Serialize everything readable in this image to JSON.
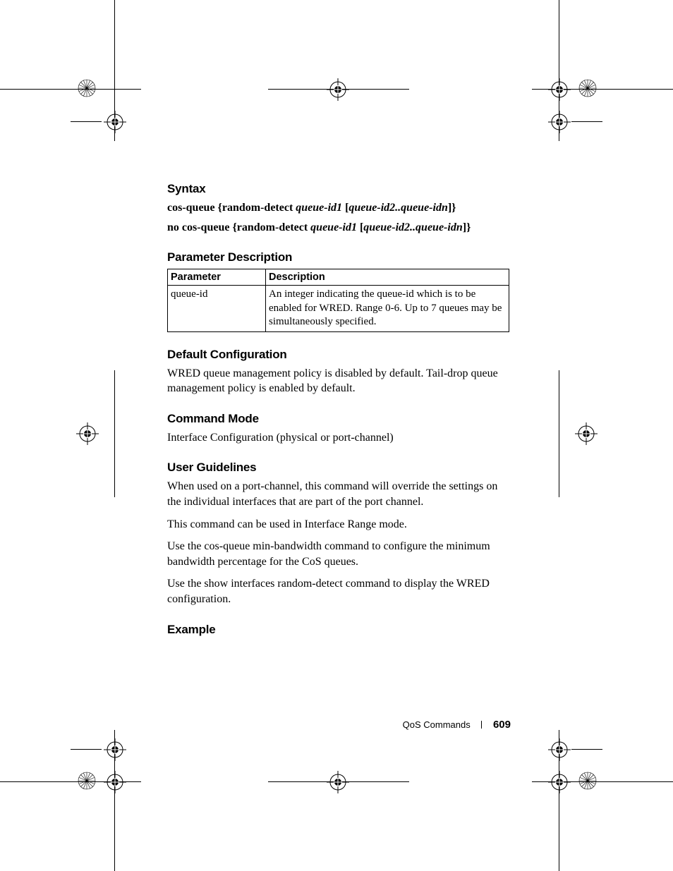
{
  "headings": {
    "syntax": "Syntax",
    "paramdesc": "Parameter Description",
    "defaultcfg": "Default Configuration",
    "cmdmode": "Command Mode",
    "userguide": "User Guidelines",
    "example": "Example"
  },
  "syntax": {
    "line1": {
      "p1": "cos-queue {random-detect ",
      "p2": "queue-id1 ",
      "p3": "[",
      "p4": "queue-id2..queue-idn",
      "p5": "]}"
    },
    "line2": {
      "p1": "no cos-queue {random-detect ",
      "p2": "queue-id1 ",
      "p3": "[",
      "p4": "queue-id2..queue-idn",
      "p5": "]}"
    }
  },
  "table": {
    "h1": "Parameter",
    "h2": "Description",
    "r1c1": "queue-id",
    "r1c2": "An integer indicating the queue-id which is to be enabled for WRED. Range 0-6. Up to 7 queues may be simultaneously specified."
  },
  "defaultcfg_text": "WRED queue management policy is disabled by default. Tail-drop queue management policy is enabled by default.",
  "cmdmode_text": "Interface Configuration (physical or port-channel)",
  "ug": {
    "p1": "When used on a port-channel, this command will override the settings on the individual interfaces that are part of the port channel.",
    "p2": "This command can be used in Interface Range mode.",
    "p3": "Use the cos-queue min-bandwidth command to configure the minimum bandwidth percentage for the CoS queues.",
    "p4": "Use the show interfaces random-detect command to display the WRED configuration."
  },
  "footer": {
    "section": "QoS Commands",
    "page": "609"
  }
}
